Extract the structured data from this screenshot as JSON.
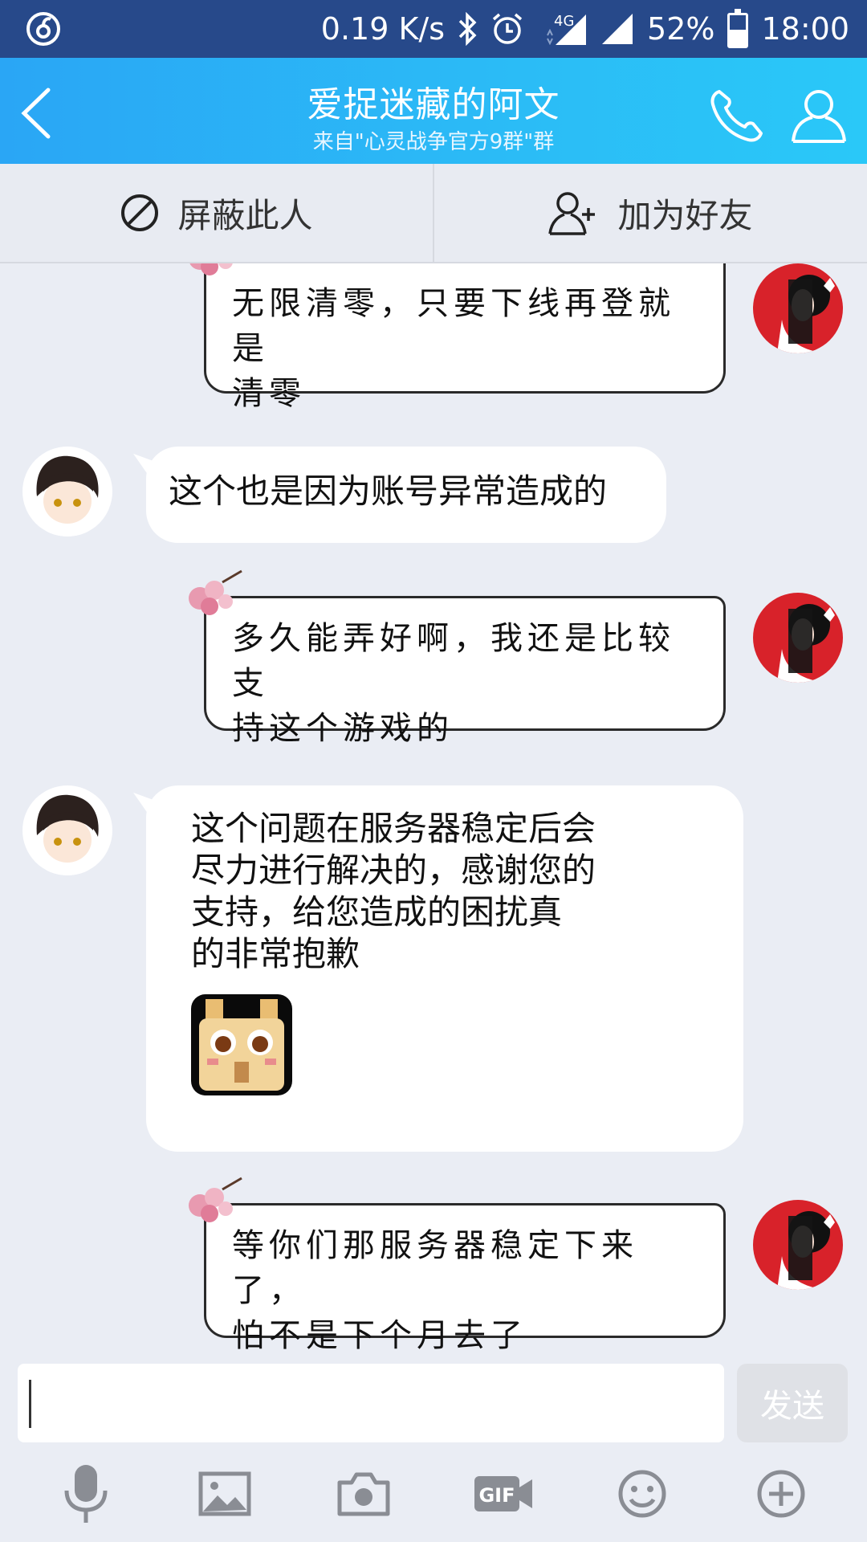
{
  "status_bar": {
    "net_speed": "0.19 K/s",
    "network": "4G",
    "battery_percent": "52%",
    "battery_level": 0.52,
    "time": "18:00",
    "icons": [
      "netease-music-icon",
      "bluetooth-icon",
      "alarm-icon",
      "signal-icon",
      "wifi-signal-icon",
      "battery-icon"
    ]
  },
  "header": {
    "title": "爱捉迷藏的阿文",
    "subtitle": "来自\"心灵战争官方9群\"群",
    "accent_color": "#2bb8f6"
  },
  "actions": {
    "block_label": "屏蔽此人",
    "add_friend_label": "加为好友"
  },
  "messages": [
    {
      "side": "right",
      "style": "fancy",
      "lines": [
        "无限清零，只要下线再登就是",
        "清零"
      ]
    },
    {
      "side": "left",
      "style": "plain",
      "lines": [
        "这个也是因为账号异常造成的"
      ]
    },
    {
      "side": "right",
      "style": "fancy",
      "lines": [
        "多久能弄好啊，我还是比较支",
        "持这个游戏的"
      ]
    },
    {
      "side": "left",
      "style": "plain",
      "lines": [
        "这个问题在服务器稳定后会",
        "尽力进行解决的，感谢您的",
        "支持，给您造成的困扰真",
        "的非常抱歉"
      ],
      "sticker": "pixel-rabbit-sticker"
    },
    {
      "side": "right",
      "style": "fancy",
      "lines": [
        "等你们那服务器稳定下来了，",
        "怕不是下个月去了"
      ]
    }
  ],
  "input": {
    "value": "",
    "placeholder": "",
    "send_label": "发送"
  },
  "toolbar": {
    "icons": [
      "microphone-icon",
      "image-icon",
      "camera-icon",
      "gif-icon",
      "emoji-icon",
      "plus-icon"
    ]
  }
}
